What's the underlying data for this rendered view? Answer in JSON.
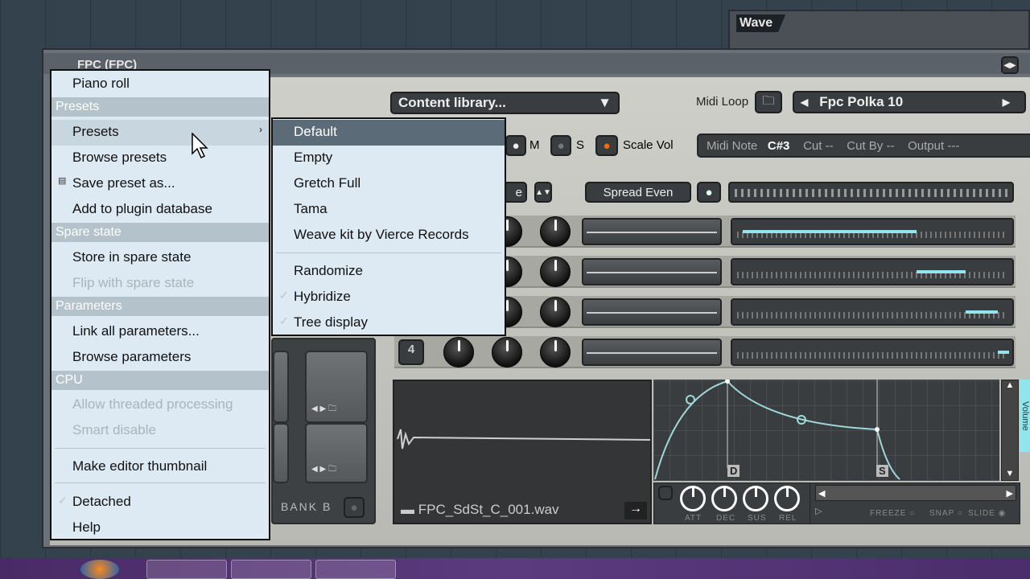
{
  "wave_panel": {
    "title": "Wave"
  },
  "window": {
    "title": "FPC (FPC)"
  },
  "toolbar": {
    "content_library": "Content library...",
    "midi_loop_label": "Midi Loop",
    "midi_loop_value": "Fpc Polka 10"
  },
  "pad_controls": {
    "m": "M",
    "s": "S",
    "scale_vol": "Scale Vol",
    "midi_note_label": "Midi Note",
    "midi_note_value": "C#3",
    "cut_label": "Cut",
    "cut_value": "--",
    "cut_by_label": "Cut By",
    "cut_by_value": "--",
    "output_label": "Output",
    "output_value": "---",
    "spread_even": "Spread Even",
    "layer_fragment": "e"
  },
  "layers": [
    {
      "fill_from": 0.02,
      "fill_to": 0.66
    },
    {
      "fill_from": 0.66,
      "fill_to": 0.84
    },
    {
      "fill_from": 0.84,
      "fill_to": 0.96
    },
    {
      "fill_from": 0.96,
      "fill_to": 1.0
    }
  ],
  "layer_number": "4",
  "bank": {
    "label": "BANK B"
  },
  "sample": {
    "filename": "FPC_SdSt_C_001.wav"
  },
  "envelope": {
    "markers": [
      "D",
      "S"
    ],
    "knobs": [
      "ATT",
      "DEC",
      "SUS",
      "REL"
    ],
    "freeze": "FREEZE",
    "snap": "SNAP",
    "slide": "SLIDE",
    "side_label": "Volume"
  },
  "menu": {
    "piano_roll": "Piano roll",
    "h_presets": "Presets",
    "presets": "Presets",
    "browse_presets": "Browse presets",
    "save_preset": "Save preset as...",
    "add_plugin_db": "Add to plugin database",
    "h_spare": "Spare state",
    "store_spare": "Store in spare state",
    "flip_spare": "Flip with spare state",
    "h_params": "Parameters",
    "link_params": "Link all parameters...",
    "browse_params": "Browse parameters",
    "h_cpu": "CPU",
    "threaded": "Allow threaded processing",
    "smart_disable": "Smart disable",
    "thumbnail": "Make editor thumbnail",
    "detached": "Detached",
    "help": "Help"
  },
  "submenu": {
    "items": [
      "Default",
      "Empty",
      "Gretch Full",
      "Tama",
      "Weave kit by Vierce Records"
    ],
    "randomize": "Randomize",
    "hybridize": "Hybridize",
    "tree_display": "Tree display"
  },
  "colors": {
    "accent": "#8fe6ec",
    "menu_bg": "#dde9f3",
    "highlight": "#5b6b77",
    "led": "#ff6a00"
  }
}
